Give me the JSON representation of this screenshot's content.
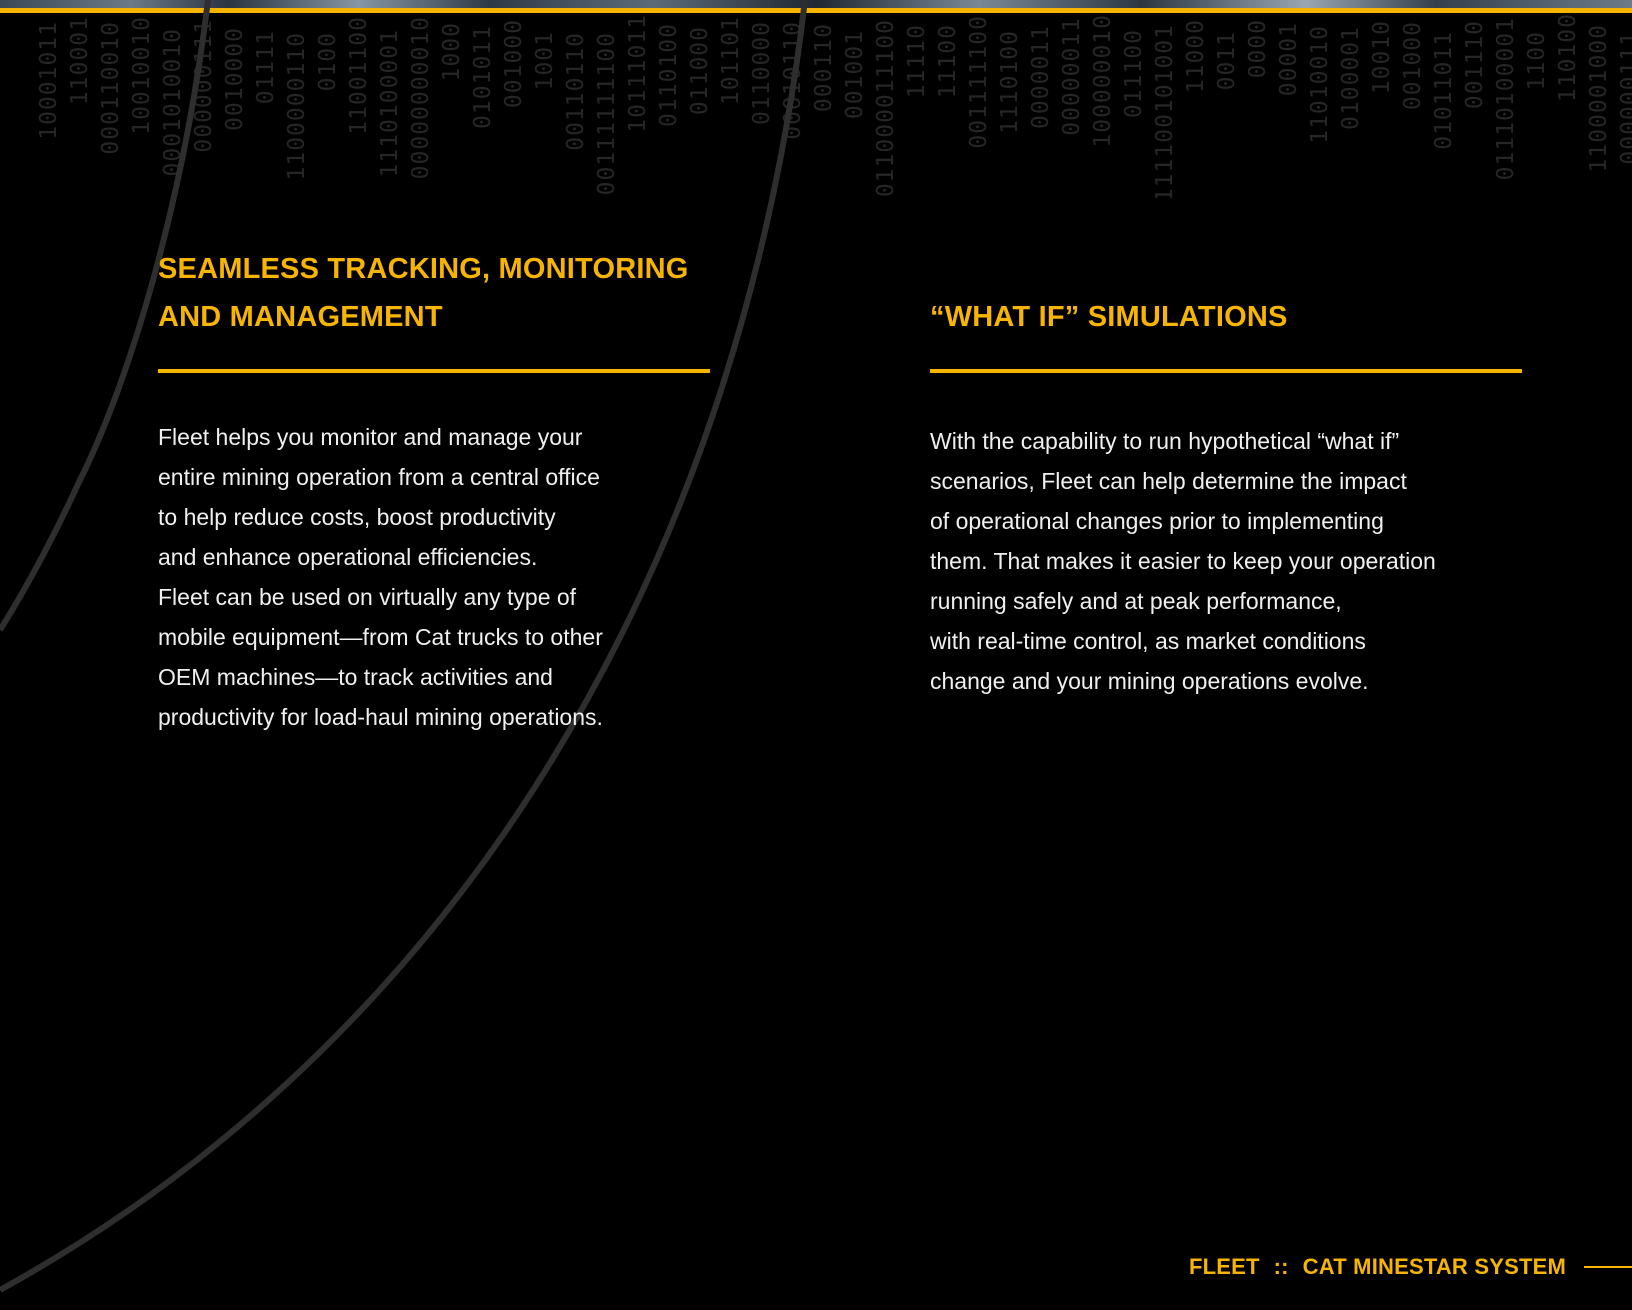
{
  "colors": {
    "accent": "#f7b500",
    "background": "#000000",
    "body_text": "#f0f0f0",
    "decor_binary": "#262626",
    "decor_arc": "#2e2e2e"
  },
  "left": {
    "title_lines": [
      "SEAMLESS TRACKING, MONITORING",
      "AND MANAGEMENT"
    ],
    "body_lines": [
      "Fleet helps you monitor and manage your",
      "entire mining operation from a central office",
      "to help reduce costs, boost productivity",
      "and enhance operational efficiencies.",
      "Fleet can be used on  virtually any type of",
      "mobile equipment—from Cat trucks to other",
      "OEM machines—to track activities and",
      "productivity for load-haul mining operations."
    ]
  },
  "right": {
    "title": "“WHAT IF” SIMULATIONS",
    "body_lines": [
      "With the capability to run hypothetical “what if”",
      "scenarios, Fleet can help determine the impact",
      "of operational changes prior to implementing",
      "them. That makes it easier to keep your operation",
      "running safely and at peak performance,",
      "with real-time control, as market conditions",
      "change and your mining operations evolve."
    ]
  },
  "footer": {
    "product": "FLEET",
    "separator": "::",
    "system": "CAT MINESTAR SYSTEM"
  }
}
